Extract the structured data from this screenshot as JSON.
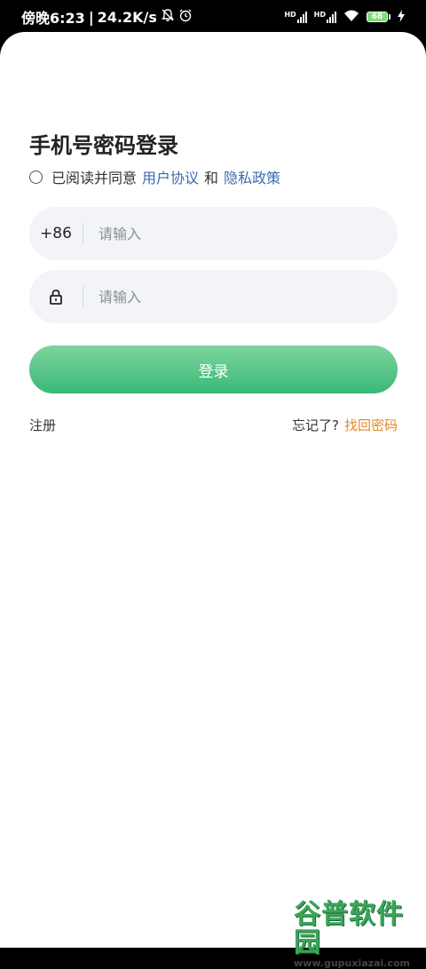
{
  "status_bar": {
    "time": "傍晚6:23",
    "separator": "|",
    "net_speed": "24.2K/s",
    "mute_icon": "bell-off-icon",
    "alarm_icon": "alarm-clock-icon",
    "hd1": "HD",
    "hd2": "HD",
    "battery": "68",
    "charging_icon": "lightning-icon",
    "wifi_icon": "wifi-icon"
  },
  "login": {
    "title": "手机号密码登录",
    "agree_prefix": "已阅读并同意",
    "user_agreement": "用户协议",
    "and": "和",
    "privacy_policy": "隐私政策",
    "phone_prefix": "+86",
    "phone_placeholder": "请输入",
    "password_icon": "lock-icon",
    "password_placeholder": "请输入",
    "login_button": "登录",
    "register": "注册",
    "forgot": "忘记了?",
    "recover": "找回密码"
  },
  "watermark": {
    "name": "谷普软件园",
    "url": "www.gupuxiazai.com"
  },
  "colors": {
    "accent_green": "#3ab878",
    "link_blue": "#3b6bb0",
    "recover_orange": "#e08a2b",
    "field_bg": "#f2f4f7"
  }
}
